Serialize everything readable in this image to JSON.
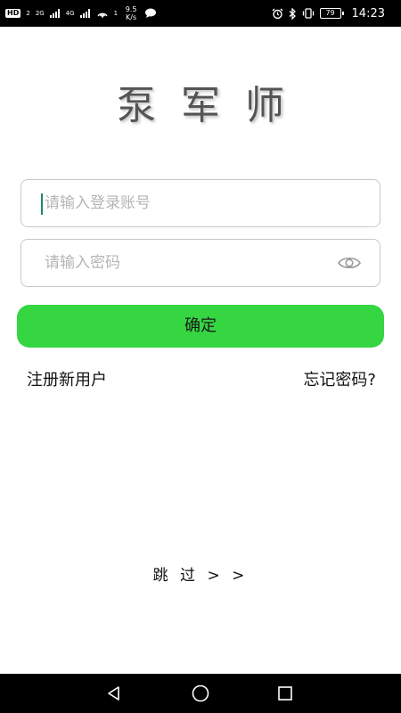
{
  "status_bar": {
    "hd_badge": "HD",
    "sim_label": "2",
    "signal_1_label": "2G",
    "signal_2_label": "4G",
    "hotspot_count": "1",
    "net_speed_value": "9.5",
    "net_speed_unit": "K/s",
    "battery": "79",
    "time": "14:23"
  },
  "app": {
    "logo_text": "泵军师"
  },
  "login": {
    "account_placeholder": "请输入登录账号",
    "account_value": "",
    "password_placeholder": "请输入密码",
    "password_value": "",
    "confirm_label": "确定"
  },
  "links": {
    "register": "注册新用户",
    "forgot_password": "忘记密码?",
    "skip": "跳 过 > >"
  },
  "colors": {
    "confirm_button": "#35d642",
    "caret": "#1b8a6b",
    "status_bar_bg": "#000000",
    "nav_bar_bg": "#000000"
  },
  "icons": {
    "password_toggle": "eye-icon",
    "nav_back": "triangle-back-icon",
    "nav_home": "circle-home-icon",
    "nav_recent": "square-recent-icon"
  }
}
